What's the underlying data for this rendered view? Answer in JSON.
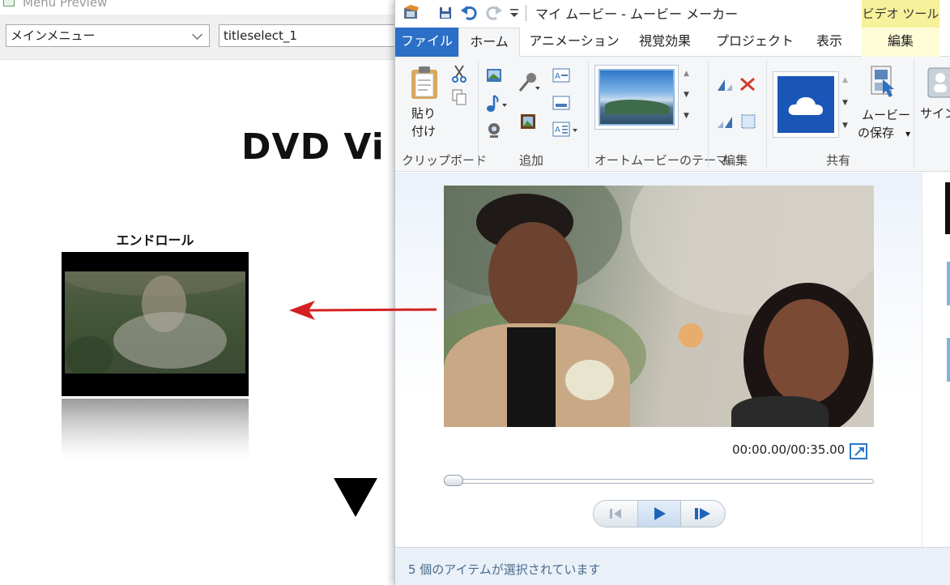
{
  "menu_preview": {
    "window_title": "Menu Preview",
    "menu_select": {
      "value": "メインメニュー"
    },
    "title_select": {
      "value": "titleselect_1"
    },
    "dvd_title": "DVD Vi",
    "thumbnail_caption": "エンドロール"
  },
  "movie_maker": {
    "window_title": "マイ ムービー - ムービー メーカー",
    "context_tab_header": "ビデオ ツール",
    "tabs": [
      {
        "label": "ファイル"
      },
      {
        "label": "ホーム"
      },
      {
        "label": "アニメーション"
      },
      {
        "label": "視覚効果"
      },
      {
        "label": "プロジェクト"
      },
      {
        "label": "表示"
      },
      {
        "label": "編集"
      }
    ],
    "ribbon": {
      "paste_label_1": "貼り",
      "paste_label_2": "付け",
      "save_movie_label_1": "ムービー",
      "save_movie_label_2": "の保存",
      "signin_label": "サイン",
      "groups": {
        "clipboard": "クリップボード",
        "add": "追加",
        "automovie_theme": "オートムービーのテーマ",
        "editing": "編集",
        "share": "共有"
      }
    },
    "player": {
      "time_readout": "00:00.00/00:35.00",
      "seek_position": 0
    },
    "status_text": "5 個のアイテムが選択されています"
  },
  "colors": {
    "file_tab": "#2b6fc7",
    "context_tab": "#f6f19a",
    "arrow": "#d42020"
  }
}
